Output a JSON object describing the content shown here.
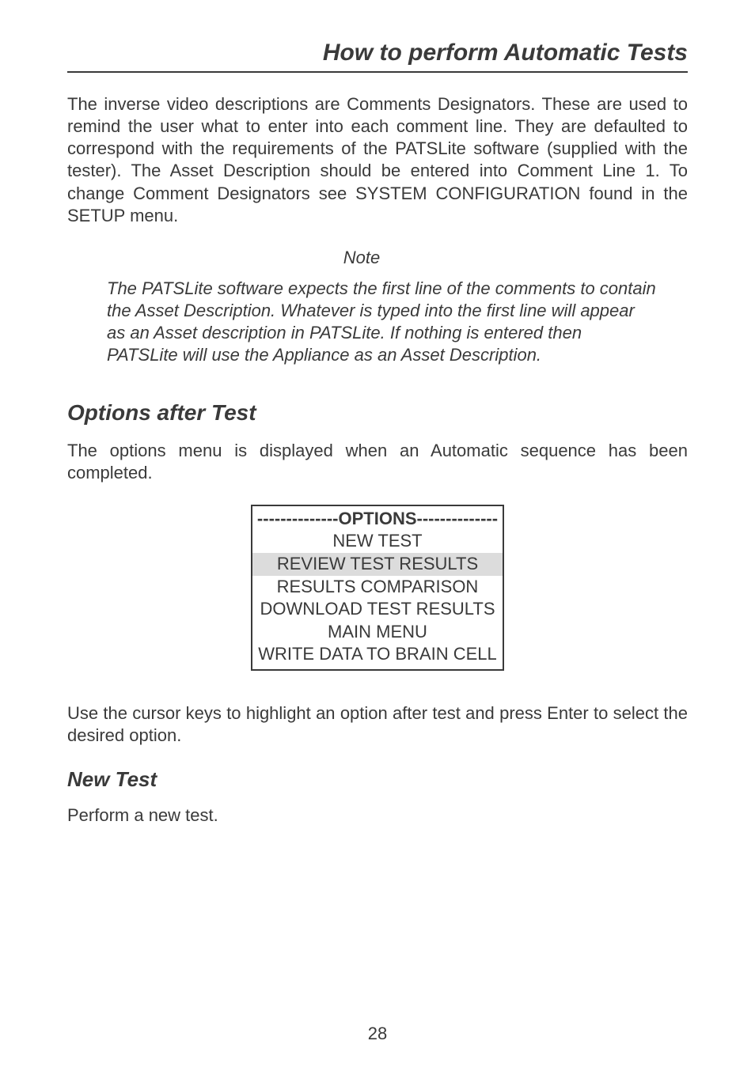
{
  "header": {
    "title": "How to perform Automatic Tests"
  },
  "paragraphs": {
    "intro": "The inverse video descriptions are Comments Designators. These are used to remind the user what to enter into each comment line. They are defaulted to correspond with the requirements of the PATSLite software (supplied with the tester). The Asset Description should be entered into Comment Line 1. To change Comment Designators see SYSTEM CONFIGURATION found in the SETUP menu.",
    "note_label": "Note",
    "note_body": "The PATSLite software expects the first line of the comments to contain the Asset Description. Whatever is typed into the first line will appear as an Asset description in PATSLite. If nothing is entered then PATSLite will use the Appliance as an Asset Description.",
    "after_options": "Use the cursor keys to highlight an option after test and press Enter to select the desired option.",
    "new_test_body": "Perform a new test."
  },
  "headings": {
    "options_after_test": "Options after Test",
    "new_test": "New Test"
  },
  "options_menu": {
    "header": "--------------OPTIONS--------------",
    "items": [
      "NEW TEST",
      "REVIEW TEST RESULTS",
      "RESULTS COMPARISON",
      "DOWNLOAD TEST RESULTS",
      "MAIN MENU",
      "WRITE DATA TO BRAIN CELL"
    ],
    "intro": "The options menu is displayed when an Automatic sequence has been completed."
  },
  "page_number": "28"
}
